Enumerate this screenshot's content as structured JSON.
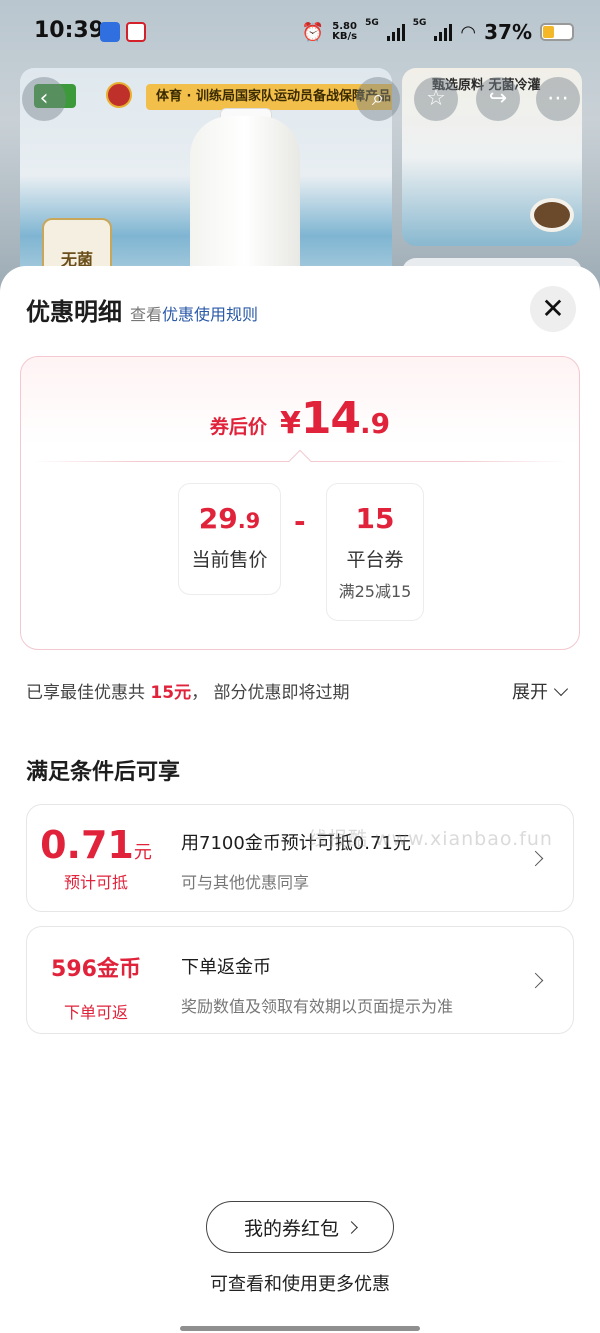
{
  "status_bar": {
    "time": "10:39",
    "net_speed_value": "5.80",
    "net_speed_unit": "KB/s",
    "signal_1_label": "5G",
    "signal_2_label": "5G",
    "battery_percent": "37%",
    "battery_level": 0.37,
    "battery_color": "#f4b728"
  },
  "background": {
    "banner_tag": "体育 · 训练局国家队运动员备战保障产品",
    "sterile_badge": "无菌",
    "side_title": "甄选原料 无菌冷灌"
  },
  "nav": {
    "back_icon": "back-arrow-icon",
    "search_icon": "search-icon",
    "favorite_icon": "star-icon",
    "share_icon": "share-icon",
    "more_icon": "more-icon"
  },
  "sheet": {
    "title": "优惠明细",
    "rule_prefix": "查看",
    "rule_link": "优惠使用规则",
    "close_label": "✕"
  },
  "price_card": {
    "after_label": "券后价",
    "currency": "¥",
    "after_int": "14",
    "after_dec": ".9",
    "minus": "-",
    "sale": {
      "int": "29",
      "dec": ".9",
      "label": "当前售价"
    },
    "coupon": {
      "value": "15",
      "label": "平台券",
      "condition": "满25减15"
    }
  },
  "summary": {
    "prefix": "已享最佳优惠共 ",
    "amount": "15元",
    "suffix": "， 部分优惠即将过期",
    "expand_label": "展开"
  },
  "section": {
    "title": "满足条件后可享"
  },
  "benefits": [
    {
      "big": "0.71",
      "unit": "元",
      "small": "预计可抵",
      "title": "用7100金币预计可抵0.71元",
      "desc": "可与其他优惠同享"
    },
    {
      "big": "596金币",
      "small": "下单可返",
      "title": "下单返金币",
      "desc": "奖励数值及领取有效期以页面提示为准"
    }
  ],
  "watermark": "线报酷 www.xianbao.fun",
  "footer": {
    "button_label": "我的券红包",
    "hint": "可查看和使用更多优惠"
  },
  "colors": {
    "accent_red": "#e0233b",
    "link_blue": "#2b5aa8"
  }
}
